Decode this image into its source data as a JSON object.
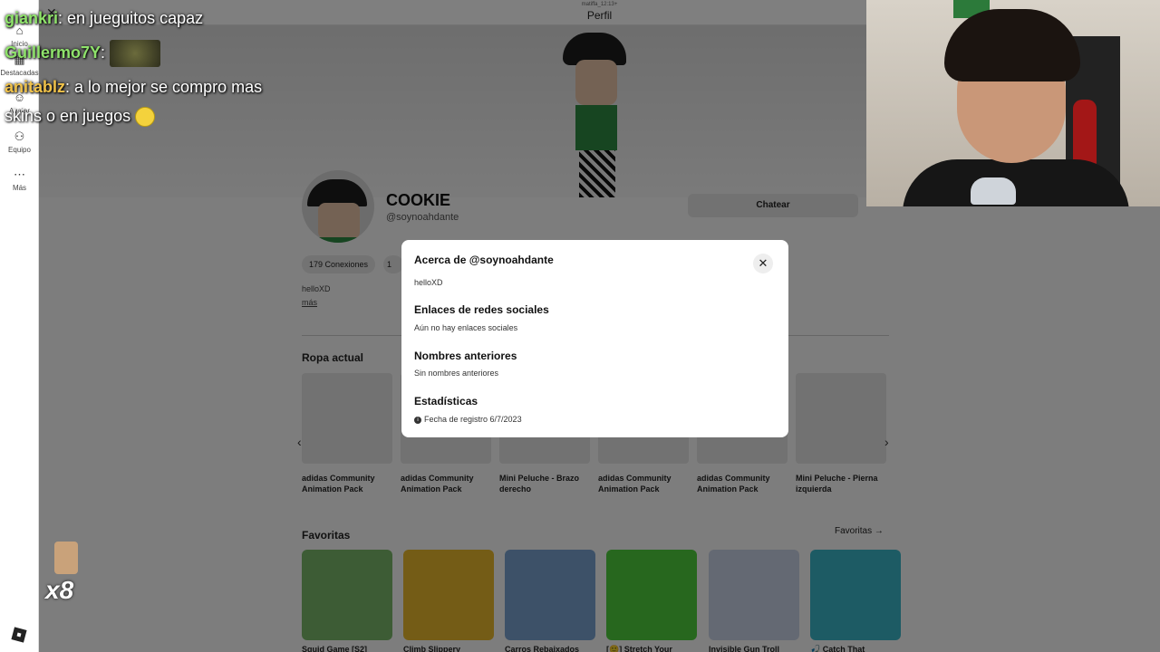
{
  "topbar": {
    "subtitle": "matiffa_12:13+",
    "title": "Perfil"
  },
  "nav": {
    "items": [
      {
        "label": "Inicio",
        "icon": "home-icon"
      },
      {
        "label": "Destacadas",
        "icon": "grid-icon"
      },
      {
        "label": "Avatar",
        "icon": "avatar-icon"
      },
      {
        "label": "Equipo",
        "icon": "people-icon"
      },
      {
        "label": "Más",
        "icon": "more-icon"
      }
    ]
  },
  "profile": {
    "display_name": "COOKIE",
    "username": "@soynoahdante",
    "chat_button": "Chatear",
    "connections": "179 Conexiones",
    "followers_partial": "1 Se",
    "bio": "helloXD",
    "more_link": "más"
  },
  "outfit": {
    "title": "Ropa actual",
    "items": [
      "adidas Community Animation Pack",
      "adidas Community Animation Pack",
      "Mini Peluche - Brazo derecho",
      "adidas Community Animation Pack",
      "adidas Community Animation Pack",
      "Mini Peluche - Pierna izquierda"
    ]
  },
  "favorites": {
    "title": "Favoritas",
    "link": "Favoritas →",
    "games": [
      {
        "title": "Squid Game [S2]",
        "color": "#7ab86a"
      },
      {
        "title": "Climb Slippery",
        "color": "#e8b82c"
      },
      {
        "title": "Carros Rebaixados",
        "color": "#7aa2d0"
      },
      {
        "title": "[🙂] Stretch Your",
        "color": "#4fcf3c"
      },
      {
        "title": "Invisible Gun Troll",
        "color": "#c9d3e6"
      },
      {
        "title": "🎣 Catch That",
        "color": "#3bb6c9"
      }
    ]
  },
  "modal": {
    "title": "Acerca de @soynoahdante",
    "bio": "helloXD",
    "social_title": "Enlaces de redes sociales",
    "social_text": "Aún no hay enlaces sociales",
    "names_title": "Nombres anteriores",
    "names_text": "Sin nombres anteriores",
    "stats_title": "Estadísticas",
    "stats_text": "Fecha de registro 6/7/2023"
  },
  "stream_chat": [
    {
      "user": "giankri",
      "text": ": en jueguitos capaz"
    },
    {
      "user": "Guillermo7Y",
      "text": ":"
    },
    {
      "user": "anitablz",
      "text": ": a lo mejor se compro mas"
    },
    {
      "user": "",
      "text": "skins o en juegos"
    }
  ],
  "badge": {
    "multiplier": "x8"
  }
}
